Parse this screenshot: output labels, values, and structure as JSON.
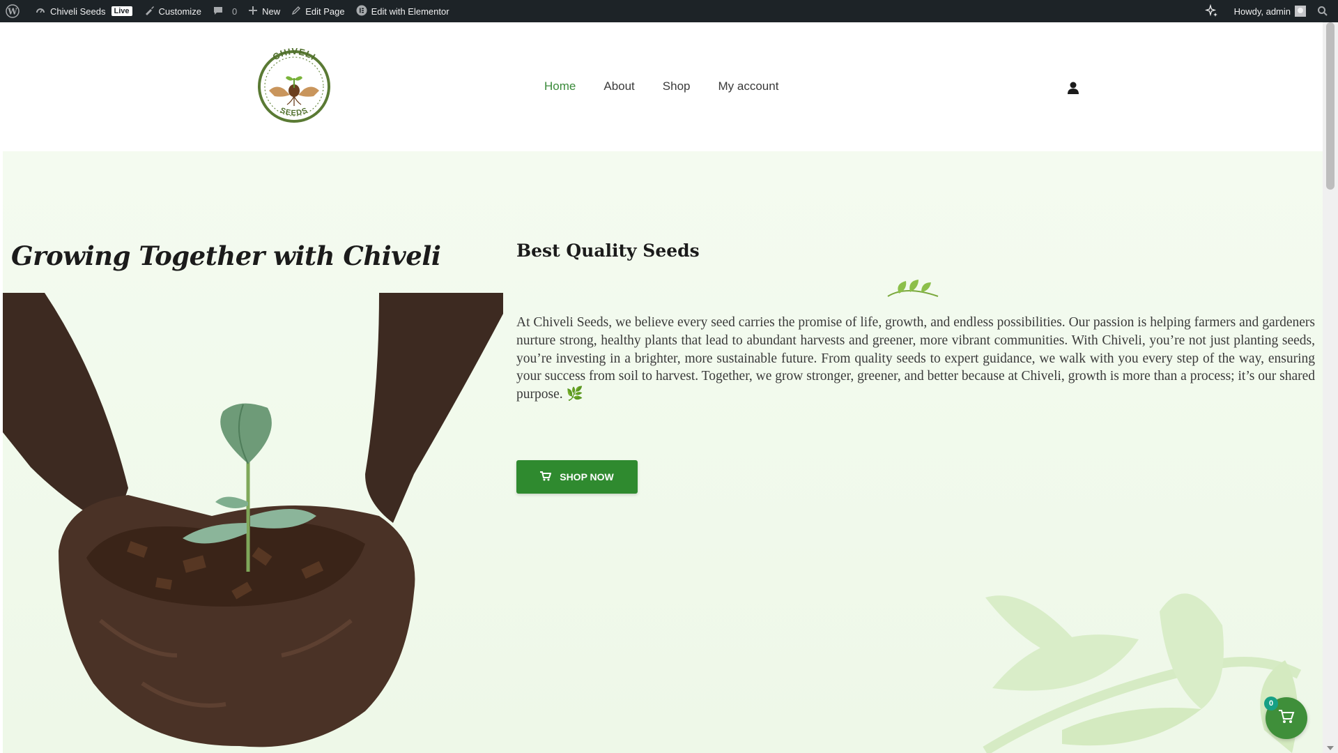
{
  "admin_bar": {
    "site_name": "Chiveli Seeds",
    "live_label": "Live",
    "customize_label": "Customize",
    "comments_count": "0",
    "new_label": "New",
    "edit_page_label": "Edit Page",
    "elementor_label": "Edit with Elementor",
    "greeting": "Howdy, admin"
  },
  "header": {
    "logo": {
      "top_text": "CHIVELI",
      "bottom_text": "SEEDS"
    },
    "nav": [
      {
        "label": "Home",
        "active": true
      },
      {
        "label": "About",
        "active": false
      },
      {
        "label": "Shop",
        "active": false
      },
      {
        "label": "My account",
        "active": false
      }
    ]
  },
  "hero": {
    "title": "Growing Together with Chiveli",
    "section_title": "Best Quality Seeds",
    "body": "At Chiveli Seeds, we believe every seed carries the promise of life, growth, and endless possibilities. Our passion is helping farmers and gardeners nurture strong, healthy plants that lead to abundant harvests and greener, more vibrant communities. With Chiveli, you’re not just planting seeds, you’re investing in a brighter, more sustainable future. From quality seeds to expert guidance, we walk with you every step of the way, ensuring your success from soil to harvest. Together, we grow stronger, greener, and better because at Chiveli, growth is more than a process; it’s our shared purpose.",
    "body_emoji": "🌿",
    "cta_label": "SHOP NOW"
  },
  "cart": {
    "count": "0"
  },
  "colors": {
    "accent_green": "#2f8a2f",
    "nav_active": "#3a8a3a",
    "admin_bg": "#1d2327"
  }
}
